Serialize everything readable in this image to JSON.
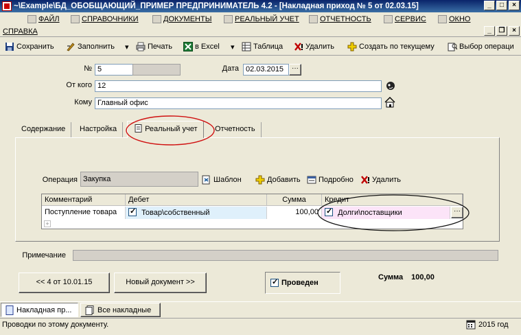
{
  "window": {
    "title": "~\\Example\\БД_ОБОБЩАЮЩИЙ_ПРИМЕР ПРЕДПРИНИМАТЕЛЬ 4.2 - [Накладная приход № 5 от 02.03.15]"
  },
  "menu": {
    "file": "ФАЙЛ",
    "directories": "СПРАВОЧНИКИ",
    "documents": "ДОКУМЕНТЫ",
    "real_accounting": "РЕАЛЬНЫЙ УЧЕТ",
    "reports": "ОТЧЕТНОСТЬ",
    "service": "СЕРВИС",
    "window": "ОКНО",
    "help": "СПРАВКА"
  },
  "toolbar": {
    "save": "Сохранить",
    "fill": "Заполнить",
    "print": "Печать",
    "to_excel": "в Excel",
    "table": "Таблица",
    "delete": "Удалить",
    "create_from_current": "Создать по текущему",
    "select_operation": "Выбор операци"
  },
  "form": {
    "number_label": "№",
    "number_value": "5",
    "date_label": "Дата",
    "date_value": "02.03.2015",
    "from_label": "От кого",
    "from_value": "12",
    "to_label": "Кому",
    "to_value": "Главный офис"
  },
  "tabs": {
    "content": "Содержание",
    "settings": "Настройка",
    "real_accounting": "Реальный учет",
    "reports": "Отчетность"
  },
  "operation": {
    "label": "Операция",
    "value": "Закупка",
    "template": "Шаблон",
    "add": "Добавить",
    "details": "Подробно",
    "delete": "Удалить"
  },
  "grid": {
    "headers": {
      "comment": "Комментарий",
      "debit": "Дебет",
      "sum": "Сумма",
      "credit": "Кредит"
    },
    "row": {
      "comment": "Поступление товара",
      "debit": "Товар\\собственный",
      "sum": "100,00",
      "credit": "Долги\\поставщики"
    }
  },
  "note_label": "Примечание",
  "nav": {
    "prev": "<< 4 от 10.01.15",
    "new_doc": "Новый документ >>"
  },
  "posted_label": "Проведен",
  "total": {
    "label": "Сумма",
    "value": "100,00"
  },
  "taskbar": {
    "tab1": "Накладная пр...",
    "tab2": "Все накладные"
  },
  "status": {
    "text": "Проводки по этому документу.",
    "year": "2015 год"
  }
}
